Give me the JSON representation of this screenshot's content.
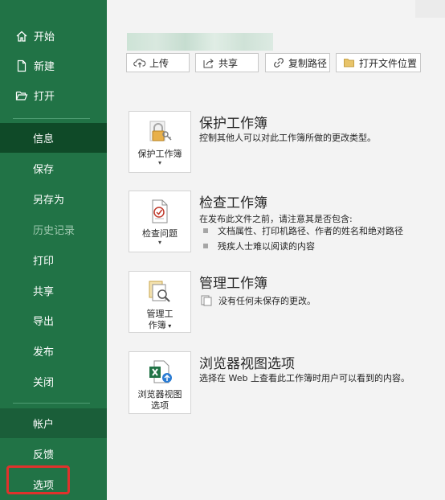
{
  "sidebar": {
    "items": [
      {
        "label": "开始",
        "icon": "home-icon"
      },
      {
        "label": "新建",
        "icon": "new-document-icon"
      },
      {
        "label": "打开",
        "icon": "open-folder-icon"
      },
      {
        "label": "信息"
      },
      {
        "label": "保存"
      },
      {
        "label": "另存为"
      },
      {
        "label": "历史记录"
      },
      {
        "label": "打印"
      },
      {
        "label": "共享"
      },
      {
        "label": "导出"
      },
      {
        "label": "发布"
      },
      {
        "label": "关闭"
      },
      {
        "label": "帐户"
      },
      {
        "label": "反馈"
      },
      {
        "label": "选项"
      }
    ],
    "selected": "信息",
    "accent": "#217346",
    "highlight_color": "#e0322c"
  },
  "toolbar": {
    "upload": "上传",
    "share": "共享",
    "copy_path": "复制路径",
    "open_location": "打开文件位置"
  },
  "sections": {
    "protect": {
      "button": "保护工作簿",
      "title": "保护工作簿",
      "desc": "控制其他人可以对此工作簿所做的更改类型。"
    },
    "inspect": {
      "button": "检查问题",
      "title": "检查工作簿",
      "desc": "在发布此文件之前，请注意其是否包含:",
      "bullets": [
        "文档属性、打印机路径、作者的姓名和绝对路径",
        "残疾人士难以阅读的内容"
      ]
    },
    "manage": {
      "button_line1": "管理工",
      "button_line2": "作簿",
      "title": "管理工作簿",
      "desc": "没有任何未保存的更改。"
    },
    "browser": {
      "button_line1": "浏览器视图",
      "button_line2": "选项",
      "title": "浏览器视图选项",
      "desc": "选择在 Web 上查看此工作簿时用户可以看到的内容。"
    }
  }
}
